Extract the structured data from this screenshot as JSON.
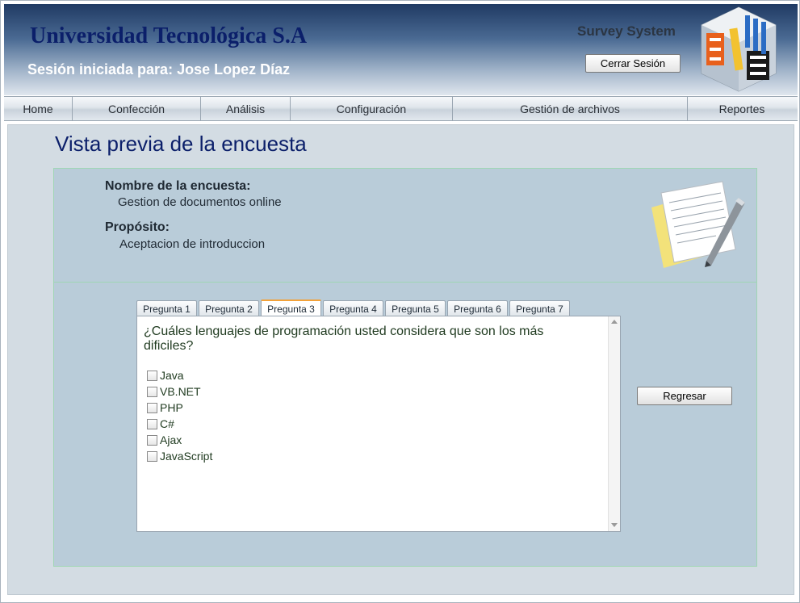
{
  "header": {
    "university": "Universidad Tecnológica S.A",
    "session": "Sesión iniciada para: Jose Lopez Díaz",
    "system_name": "Survey System",
    "logout_label": "Cerrar Sesión",
    "logo_icon": "survey-system-logo-icon"
  },
  "menu": {
    "items": [
      {
        "label": "Home"
      },
      {
        "label": "Confección"
      },
      {
        "label": "Análisis"
      },
      {
        "label": "Configuración"
      },
      {
        "label": "Gestión de archivos"
      },
      {
        "label": "Reportes"
      }
    ]
  },
  "page": {
    "title": "Vista previa de la encuesta"
  },
  "survey": {
    "name_label": "Nombre de la encuesta:",
    "name_value": "Gestion de documentos online",
    "purpose_label": "Propósito:",
    "purpose_value": "Aceptacion de introduccion",
    "icon": "document-pen-icon"
  },
  "tabs": [
    {
      "label": "Pregunta 1"
    },
    {
      "label": "Pregunta 2"
    },
    {
      "label": "Pregunta 3"
    },
    {
      "label": "Pregunta 4"
    },
    {
      "label": "Pregunta 5"
    },
    {
      "label": "Pregunta 6"
    },
    {
      "label": "Pregunta 7"
    }
  ],
  "active_tab": "Pregunta 3",
  "question": {
    "text": "¿Cuáles lenguajes de programación usted considera que son los más dificiles?",
    "options": [
      {
        "label": "Java",
        "checked": false
      },
      {
        "label": "VB.NET",
        "checked": false
      },
      {
        "label": "PHP",
        "checked": false
      },
      {
        "label": "C#",
        "checked": false
      },
      {
        "label": "Ajax",
        "checked": false
      },
      {
        "label": "JavaScript",
        "checked": false
      }
    ]
  },
  "actions": {
    "back_label": "Regresar"
  },
  "colors": {
    "title": "#0b1f6a",
    "panel": "#b9ccd9",
    "content_bg": "#d3dce3",
    "active_tab_accent": "#f3a23a"
  }
}
